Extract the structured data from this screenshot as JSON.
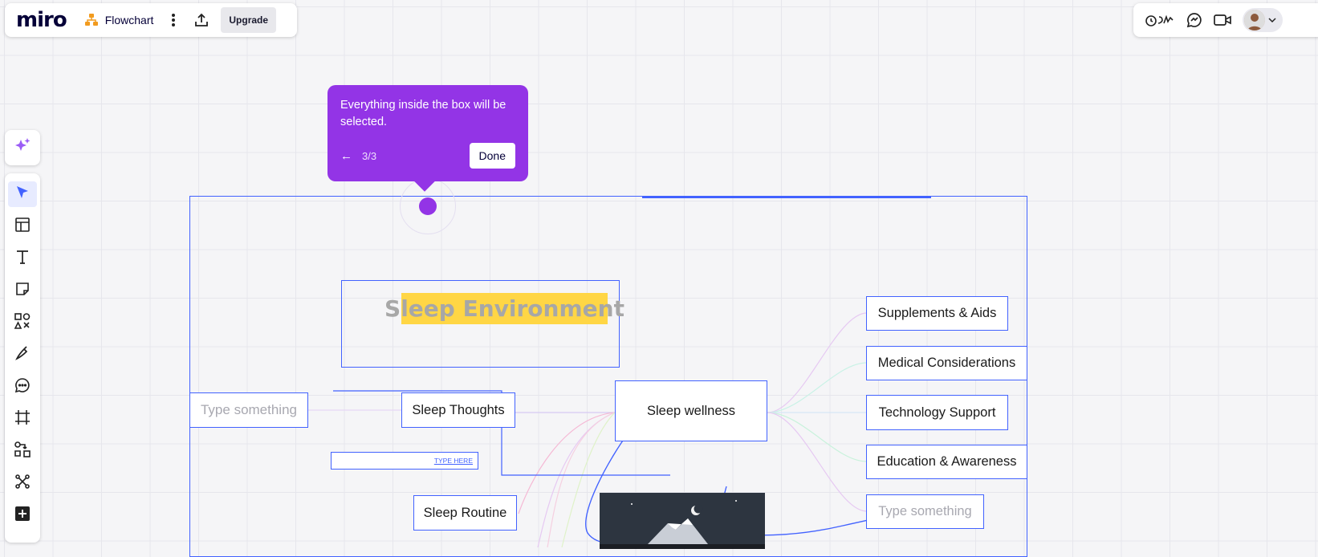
{
  "app": {
    "logo": "miro",
    "board_name": "Flowchart",
    "upgrade_label": "Upgrade"
  },
  "topright": {
    "icons": [
      "reactions-icon",
      "chat-icon",
      "video-icon",
      "avatar",
      "chevron-down-icon"
    ]
  },
  "toolbar": {
    "items": [
      {
        "name": "select-tool",
        "icon": "cursor-icon",
        "active": true
      },
      {
        "name": "templates-tool",
        "icon": "templates-icon"
      },
      {
        "name": "text-tool",
        "icon": "text-icon"
      },
      {
        "name": "sticky-note-tool",
        "icon": "sticky-note-icon"
      },
      {
        "name": "shapes-tool",
        "icon": "shapes-icon"
      },
      {
        "name": "pen-tool",
        "icon": "pen-icon"
      },
      {
        "name": "comment-tool",
        "icon": "comment-icon"
      },
      {
        "name": "frame-tool",
        "icon": "frame-icon"
      },
      {
        "name": "diagram-tool",
        "icon": "diagram-icon"
      },
      {
        "name": "mindmap-tool",
        "icon": "mindmap-icon"
      },
      {
        "name": "more-tool",
        "icon": "plus-icon"
      }
    ]
  },
  "tooltip": {
    "text": "Everything inside the box will be selected.",
    "step": "3/3",
    "done_label": "Done",
    "accent": "#9334e6"
  },
  "canvas": {
    "title": "Sleep Environment",
    "center": "Sleep wellness",
    "left_nodes": {
      "type_something": "Type something",
      "sleep_thoughts": "Sleep Thoughts",
      "type_here": "TYPE HERE",
      "sleep_routine": "Sleep Routine"
    },
    "right_nodes": {
      "supplements": "Supplements & Aids",
      "medical": "Medical Considerations",
      "technology": "Technology Support",
      "education": "Education & Awareness",
      "type_something": "Type something"
    },
    "selection_color": "#4262ff"
  }
}
